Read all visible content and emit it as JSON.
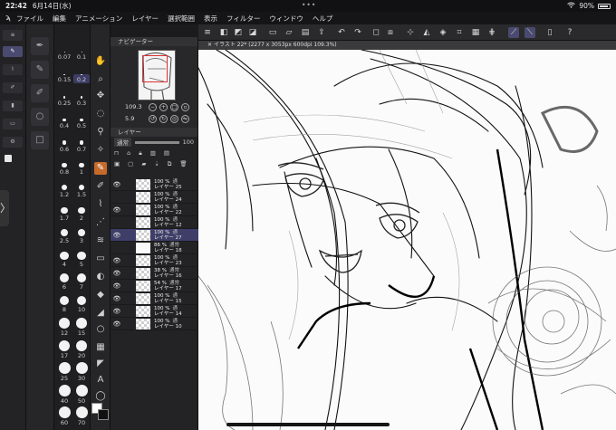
{
  "status": {
    "time": "22:42",
    "date": "6月14日(水)",
    "battery": "90%",
    "battery_level": 0.9
  },
  "menu": [
    "ファイル",
    "編集",
    "アニメーション",
    "レイヤー",
    "選択範囲",
    "表示",
    "フィルター",
    "ウィンドウ",
    "ヘルプ"
  ],
  "brush_sizes": [
    {
      "label": "0.07"
    },
    {
      "label": "0.1"
    },
    {
      "label": "0.15"
    },
    {
      "label": "0.2",
      "selected": true
    },
    {
      "label": "0.25"
    },
    {
      "label": "0.3"
    },
    {
      "label": "0.4"
    },
    {
      "label": "0.5"
    },
    {
      "label": "0.6"
    },
    {
      "label": "0.7"
    },
    {
      "label": "0.8"
    },
    {
      "label": "1"
    },
    {
      "label": "1.2"
    },
    {
      "label": "1.5"
    },
    {
      "label": "1.7"
    },
    {
      "label": "2"
    },
    {
      "label": "2.5"
    },
    {
      "label": "3"
    },
    {
      "label": "4"
    },
    {
      "label": "5"
    },
    {
      "label": "6"
    },
    {
      "label": "7"
    },
    {
      "label": "8"
    },
    {
      "label": "10"
    },
    {
      "label": "12"
    },
    {
      "label": "15"
    },
    {
      "label": "17"
    },
    {
      "label": "20"
    },
    {
      "label": "25"
    },
    {
      "label": "30"
    },
    {
      "label": "40"
    },
    {
      "label": "50"
    },
    {
      "label": "60"
    },
    {
      "label": "70"
    }
  ],
  "navigator": {
    "title": "ナビゲーター",
    "zoom": "109.3",
    "rotation": "5.9"
  },
  "layers_panel": {
    "title": "レイヤー",
    "blend_mode": "通常",
    "opacity": "100",
    "items": [
      {
        "opacity": "100 %",
        "mode": "通",
        "name": "レイヤー 25",
        "visible": true
      },
      {
        "opacity": "100 %",
        "mode": "通",
        "name": "レイヤー 24",
        "visible": false
      },
      {
        "opacity": "100 %",
        "mode": "通",
        "name": "レイヤー 22",
        "visible": true
      },
      {
        "opacity": "100 %",
        "mode": "通",
        "name": "レイヤー 12",
        "visible": false
      },
      {
        "opacity": "100 %",
        "mode": "通",
        "name": "レイヤー 27",
        "visible": true,
        "selected": true
      },
      {
        "opacity": "86 %",
        "mode": "通常",
        "name": "レイヤー 18",
        "visible": false,
        "solid": true
      },
      {
        "opacity": "100 %",
        "mode": "通",
        "name": "レイヤー 23",
        "visible": true
      },
      {
        "opacity": "38 %",
        "mode": "通常",
        "name": "レイヤー 16",
        "visible": true
      },
      {
        "opacity": "54 %",
        "mode": "通常",
        "name": "レイヤー 17",
        "visible": true
      },
      {
        "opacity": "100 %",
        "mode": "通",
        "name": "レイヤー 15",
        "visible": true
      },
      {
        "opacity": "100 %",
        "mode": "通",
        "name": "レイヤー 14",
        "visible": true
      },
      {
        "opacity": "100 %",
        "mode": "通",
        "name": "レイヤー 10",
        "visible": true
      }
    ]
  },
  "canvas": {
    "tab_title": "イラスト 22* (2277 x 3053px 600dpi 109.3%)"
  },
  "icons": {
    "left_tools": [
      "pen-icon",
      "ruler-icon",
      "layer-icon",
      "hand-icon"
    ],
    "tool_column": [
      "hand-icon",
      "zoom-icon",
      "move-icon",
      "lasso-icon",
      "eyedropper-icon",
      "pen-icon",
      "pencil-icon",
      "brush-icon",
      "airbrush-icon",
      "eraser-icon",
      "fill-icon",
      "gradient-icon",
      "shape-icon",
      "frame-icon",
      "ruler-icon",
      "text-icon",
      "balloon-icon"
    ]
  },
  "colors": {
    "selection_accent": "#3e3e68",
    "active_tool": "#c66a2b"
  }
}
